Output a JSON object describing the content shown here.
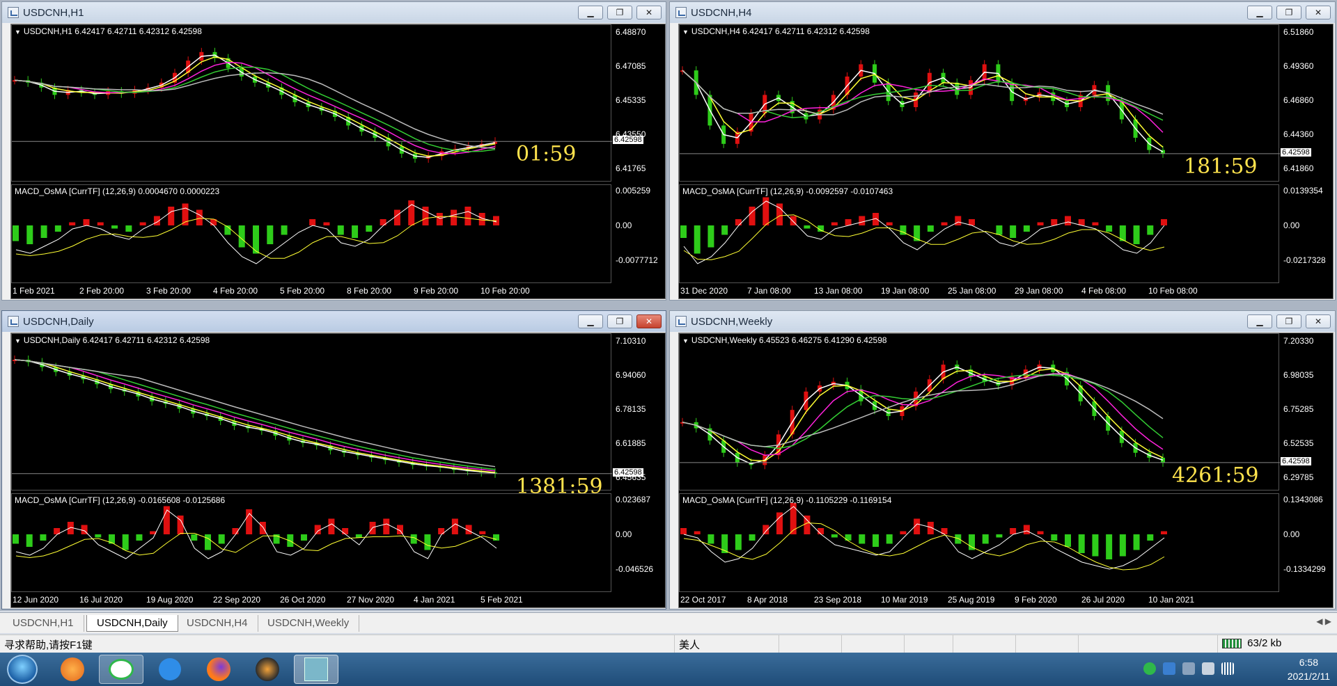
{
  "windows": {
    "h1": {
      "title": "USDCNH,H1",
      "header": "USDCNH,H1  6.42417 6.42711 6.42312 6.42598",
      "price_scale": [
        "6.48870",
        "6.47085",
        "6.45335",
        "6.43550",
        "6.41765"
      ],
      "price_tag": "6.42598",
      "timer": "01:59",
      "macd_header": "MACD_OsMA [CurrTF] (12,26,9) 0.0004670 0.0000223",
      "macd_scale": [
        "0.005259",
        "0.00",
        "-0.0077712"
      ],
      "time_labels": [
        "1 Feb 2021",
        "2 Feb 20:00",
        "3 Feb 20:00",
        "4 Feb 20:00",
        "5 Feb 20:00",
        "8 Feb 20:00",
        "9 Feb 20:00",
        "10 Feb 20:00"
      ]
    },
    "h4": {
      "title": "USDCNH,H4",
      "header": "USDCNH,H4  6.42417 6.42711 6.42312 6.42598",
      "price_scale": [
        "6.51860",
        "6.49360",
        "6.46860",
        "6.44360",
        "6.41860"
      ],
      "price_tag": "6.42598",
      "timer": "181:59",
      "macd_header": "MACD_OsMA [CurrTF] (12,26,9) -0.0092597 -0.0107463",
      "macd_scale": [
        "0.0139354",
        "0.00",
        "-0.0217328"
      ],
      "time_labels": [
        "31 Dec 2020",
        "7 Jan 08:00",
        "13 Jan 08:00",
        "19 Jan 08:00",
        "25 Jan 08:00",
        "29 Jan 08:00",
        "4 Feb 08:00",
        "10 Feb 08:00"
      ]
    },
    "daily": {
      "title": "USDCNH,Daily",
      "header": "USDCNH,Daily  6.42417 6.42711 6.42312 6.42598",
      "price_scale": [
        "7.10310",
        "6.94060",
        "6.78135",
        "6.61885",
        "6.45635"
      ],
      "price_tag": "6.42598",
      "timer": "1381:59",
      "macd_header": "MACD_OsMA [CurrTF] (12,26,9) -0.0165608 -0.0125686",
      "macd_scale": [
        "0.023687",
        "0.00",
        "-0.046526"
      ],
      "time_labels": [
        "12 Jun 2020",
        "16 Jul 2020",
        "19 Aug 2020",
        "22 Sep 2020",
        "26 Oct 2020",
        "27 Nov 2020",
        "4 Jan 2021",
        "5 Feb 2021"
      ]
    },
    "weekly": {
      "title": "USDCNH,Weekly",
      "header": "USDCNH,Weekly  6.45523 6.46275 6.41290 6.42598",
      "price_scale": [
        "7.20330",
        "6.98035",
        "6.75285",
        "6.52535",
        "6.29785"
      ],
      "price_tag": "6.42598",
      "timer": "4261:59",
      "macd_header": "MACD_OsMA [CurrTF] (12,26,9) -0.1105229 -0.1169154",
      "macd_scale": [
        "0.1343086",
        "0.00",
        "-0.1334299"
      ],
      "time_labels": [
        "22 Oct 2017",
        "8 Apr 2018",
        "23 Sep 2018",
        "10 Mar 2019",
        "25 Aug 2019",
        "9 Feb 2020",
        "26 Jul 2020",
        "10 Jan 2021"
      ]
    }
  },
  "window_buttons": {
    "minimize": "▁",
    "restore": "❐",
    "close": "✕"
  },
  "tabs": [
    "USDCNH,H1",
    "USDCNH,Daily",
    "USDCNH,H4",
    "USDCNH,Weekly"
  ],
  "active_tab": "USDCNH,Daily",
  "tab_scroll": "◀ ▶",
  "status": {
    "help": "寻求帮助,请按F1键",
    "profile": "美人",
    "traffic": "63/2 kb"
  },
  "taskbar": {
    "time": "6:58",
    "date": "2021/2/11"
  },
  "colors": {
    "bull": "#e01010",
    "bear": "#2ecc1a",
    "ma_white": "#ffffff",
    "ma_yellow": "#ffff33",
    "ma_magenta": "#ff22dd",
    "ma_green": "#33cc33",
    "ma_gray": "#bbbbbb",
    "timer": "#ffe34d"
  },
  "series": {
    "h1": [
      0.72,
      0.7,
      0.66,
      0.6,
      0.64,
      0.62,
      0.6,
      0.63,
      0.61,
      0.64,
      0.66,
      0.7,
      0.78,
      0.88,
      0.95,
      0.9,
      0.82,
      0.75,
      0.7,
      0.66,
      0.6,
      0.54,
      0.5,
      0.47,
      0.42,
      0.35,
      0.3,
      0.25,
      0.18,
      0.12,
      0.08,
      0.1,
      0.14,
      0.16,
      0.18,
      0.2,
      0.22
    ],
    "h4": [
      0.8,
      0.6,
      0.35,
      0.2,
      0.3,
      0.45,
      0.6,
      0.55,
      0.45,
      0.4,
      0.48,
      0.6,
      0.75,
      0.85,
      0.7,
      0.55,
      0.5,
      0.62,
      0.78,
      0.7,
      0.6,
      0.72,
      0.85,
      0.7,
      0.55,
      0.58,
      0.62,
      0.55,
      0.5,
      0.6,
      0.68,
      0.55,
      0.4,
      0.25,
      0.15,
      0.12
    ],
    "daily": [
      0.96,
      0.94,
      0.9,
      0.86,
      0.83,
      0.8,
      0.76,
      0.72,
      0.7,
      0.66,
      0.62,
      0.6,
      0.56,
      0.52,
      0.5,
      0.46,
      0.42,
      0.4,
      0.38,
      0.34,
      0.3,
      0.28,
      0.26,
      0.22,
      0.2,
      0.18,
      0.16,
      0.14,
      0.12,
      0.1,
      0.09,
      0.08,
      0.06,
      0.05,
      0.04,
      0.03
    ],
    "weekly": [
      0.45,
      0.4,
      0.3,
      0.2,
      0.12,
      0.1,
      0.18,
      0.35,
      0.55,
      0.7,
      0.75,
      0.78,
      0.72,
      0.62,
      0.55,
      0.5,
      0.58,
      0.7,
      0.8,
      0.92,
      0.88,
      0.82,
      0.78,
      0.75,
      0.82,
      0.88,
      0.92,
      0.86,
      0.75,
      0.62,
      0.5,
      0.38,
      0.28,
      0.2,
      0.16,
      0.12
    ]
  },
  "macd_series": {
    "h1": [
      -0.5,
      -0.6,
      -0.4,
      -0.2,
      0.1,
      0.2,
      0.1,
      -0.1,
      -0.2,
      0.1,
      0.3,
      0.6,
      0.7,
      0.5,
      0.2,
      -0.3,
      -0.7,
      -0.9,
      -0.6,
      -0.3,
      0.0,
      0.2,
      0.1,
      -0.3,
      -0.4,
      -0.2,
      0.2,
      0.5,
      0.8,
      0.6,
      0.4,
      0.5,
      0.6,
      0.4,
      0.3
    ],
    "h4": [
      -0.4,
      -0.9,
      -0.7,
      -0.3,
      0.2,
      0.6,
      0.9,
      0.7,
      0.3,
      -0.1,
      -0.2,
      0.1,
      0.2,
      0.3,
      0.4,
      0.1,
      -0.3,
      -0.5,
      -0.2,
      0.1,
      0.3,
      0.2,
      0.0,
      -0.3,
      -0.4,
      -0.2,
      0.1,
      0.2,
      0.3,
      0.2,
      0.1,
      -0.2,
      -0.5,
      -0.6,
      -0.3,
      0.2
    ],
    "daily": [
      -0.3,
      -0.4,
      -0.2,
      0.2,
      0.4,
      0.3,
      -0.1,
      -0.3,
      -0.5,
      -0.2,
      0.1,
      0.9,
      0.6,
      -0.2,
      -0.5,
      -0.3,
      0.2,
      0.8,
      0.4,
      -0.3,
      -0.4,
      -0.2,
      0.3,
      0.5,
      0.2,
      -0.1,
      0.4,
      0.5,
      0.3,
      -0.3,
      -0.5,
      0.2,
      0.5,
      0.3,
      0.1,
      -0.2
    ],
    "weekly": [
      0.2,
      0.1,
      -0.3,
      -0.6,
      -0.5,
      -0.2,
      0.3,
      0.7,
      1.0,
      0.6,
      0.2,
      -0.1,
      -0.2,
      -0.3,
      -0.4,
      -0.3,
      0.1,
      0.5,
      0.4,
      0.2,
      -0.3,
      -0.5,
      -0.3,
      -0.1,
      0.2,
      0.3,
      0.1,
      -0.2,
      -0.4,
      -0.6,
      -0.7,
      -0.8,
      -0.7,
      -0.5,
      -0.2,
      0.1
    ]
  }
}
